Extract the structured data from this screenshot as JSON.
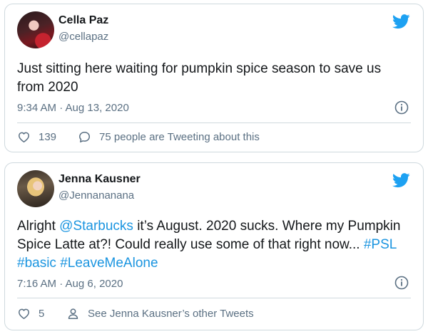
{
  "tweets": [
    {
      "name": "Cella Paz",
      "handle": "@cellapaz",
      "text": "Just sitting here waiting for pumpkin spice season to save us from 2020",
      "meta": "9:34 AM · Aug 13, 2020",
      "likes": "139",
      "secondary_action": "75 people are Tweeting about this",
      "icons": [
        "avatar",
        "twitter-bird-icon",
        "info-icon",
        "heart-icon",
        "speech-bubble-icon"
      ]
    },
    {
      "name": "Jenna Kausner",
      "handle": "@Jennananana",
      "text_parts": [
        "Alright ",
        "@Starbucks",
        " it’s August. 2020 sucks. Where my Pumpkin Spice Latte at?! Could really use some of that right now... ",
        "#PSL",
        " ",
        "#basic",
        " ",
        "#LeaveMeAlone"
      ],
      "meta": "7:16 AM · Aug 6, 2020",
      "likes": "5",
      "secondary_action": "See Jenna Kausner’s other Tweets",
      "icons": [
        "avatar",
        "twitter-bird-icon",
        "info-icon",
        "heart-icon",
        "person-icon"
      ]
    }
  ],
  "colors": {
    "twitter_blue": "#1da1f2",
    "link_blue": "#1b95e0",
    "text": "#14171a",
    "muted": "#5b7083",
    "border": "#cfd9de"
  }
}
